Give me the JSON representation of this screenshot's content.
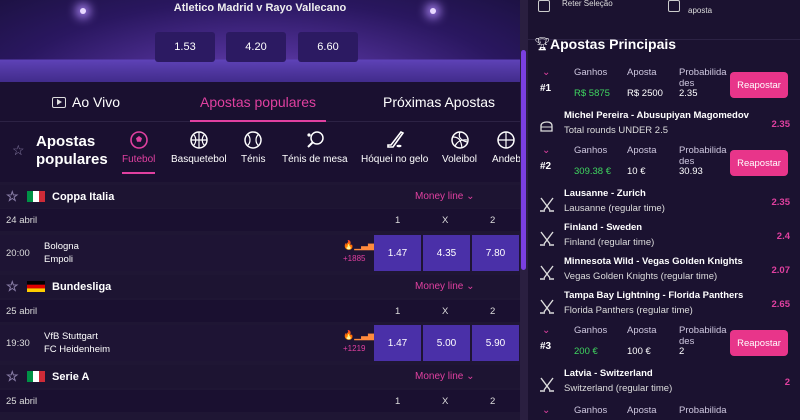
{
  "hero": {
    "match": "Atletico Madrid  v  Rayo Vallecano",
    "odds": [
      "1.53",
      "4.20",
      "6.60"
    ]
  },
  "tabs": [
    "Ao Vivo",
    "Apostas populares",
    "Próximas Apostas"
  ],
  "popular": {
    "title": "Apostas populares",
    "sports": [
      "Futebol",
      "Basquetebol",
      "Ténis",
      "Ténis de mesa",
      "Hóquei no gelo",
      "Voleibol",
      "Andeb"
    ]
  },
  "leagues": [
    {
      "name": "Coppa Italia",
      "money": "Money line",
      "date": "24 abril",
      "cols": [
        "1",
        "X",
        "2"
      ],
      "time": "20:00",
      "home": "Bologna",
      "away": "Empoli",
      "more": "+1885",
      "odds": [
        "1.47",
        "4.35",
        "7.80"
      ]
    },
    {
      "name": "Bundesliga",
      "money": "Money line",
      "date": "25 abril",
      "cols": [
        "1",
        "X",
        "2"
      ],
      "time": "19:30",
      "home": "VfB Stuttgart",
      "away": "FC Heidenheim",
      "more": "+1219",
      "odds": [
        "1.47",
        "5.00",
        "5.90"
      ]
    },
    {
      "name": "Serie A",
      "money": "Money line",
      "date": "25 abril",
      "cols": [
        "1",
        "X",
        "2"
      ]
    }
  ],
  "top_right": {
    "reter": "Reter Seleção",
    "aposta": "aposta"
  },
  "panel": {
    "title": "Apostas Principais"
  },
  "bets": [
    {
      "num": "#1",
      "labels": [
        "Ganhos",
        "Aposta",
        "Probabilida",
        "des"
      ],
      "ganhos": "R$ 5875",
      "aposta": "R$ 2500",
      "prob": "2.35",
      "button": "Reapostar"
    },
    {
      "num": "#2",
      "labels": [
        "Ganhos",
        "Aposta",
        "Probabilida",
        "des"
      ],
      "ganhos": "309.38 €",
      "aposta": "10 €",
      "prob": "30.93",
      "button": "Reapostar"
    },
    {
      "num": "#3",
      "labels": [
        "Ganhos",
        "Aposta",
        "Probabilida",
        "des"
      ],
      "ganhos": "200 €",
      "aposta": "100 €",
      "prob": "2",
      "button": "Reapostar"
    }
  ],
  "selections": [
    {
      "a": "Michel Pereira - Abusupiyan Magomedov",
      "b": "Total rounds UNDER 2.5",
      "odd": "2.35",
      "icon": "mma-icon"
    },
    {
      "a": "Lausanne - Zurich",
      "b": "Lausanne (regular time)",
      "odd": "2.35",
      "icon": "hockey-icon"
    },
    {
      "a": "Finland - Sweden",
      "b": "Finland (regular time)",
      "odd": "2.4",
      "icon": "hockey-icon"
    },
    {
      "a": "Minnesota Wild - Vegas Golden Knights",
      "b": "Vegas Golden Knights (regular time)",
      "odd": "2.07",
      "icon": "hockey-icon"
    },
    {
      "a": "Tampa Bay Lightning - Florida Panthers",
      "b": "Florida Panthers (regular time)",
      "odd": "2.65",
      "icon": "hockey-icon"
    },
    {
      "a": "Latvia - Switzerland",
      "b": "Switzerland (regular time)",
      "odd": "2",
      "icon": "hockey-icon"
    }
  ],
  "colors": {
    "accent": "#e040a0",
    "odds_bg": "#4a30a8",
    "button": "#e8358a",
    "win": "#3fd65f"
  }
}
